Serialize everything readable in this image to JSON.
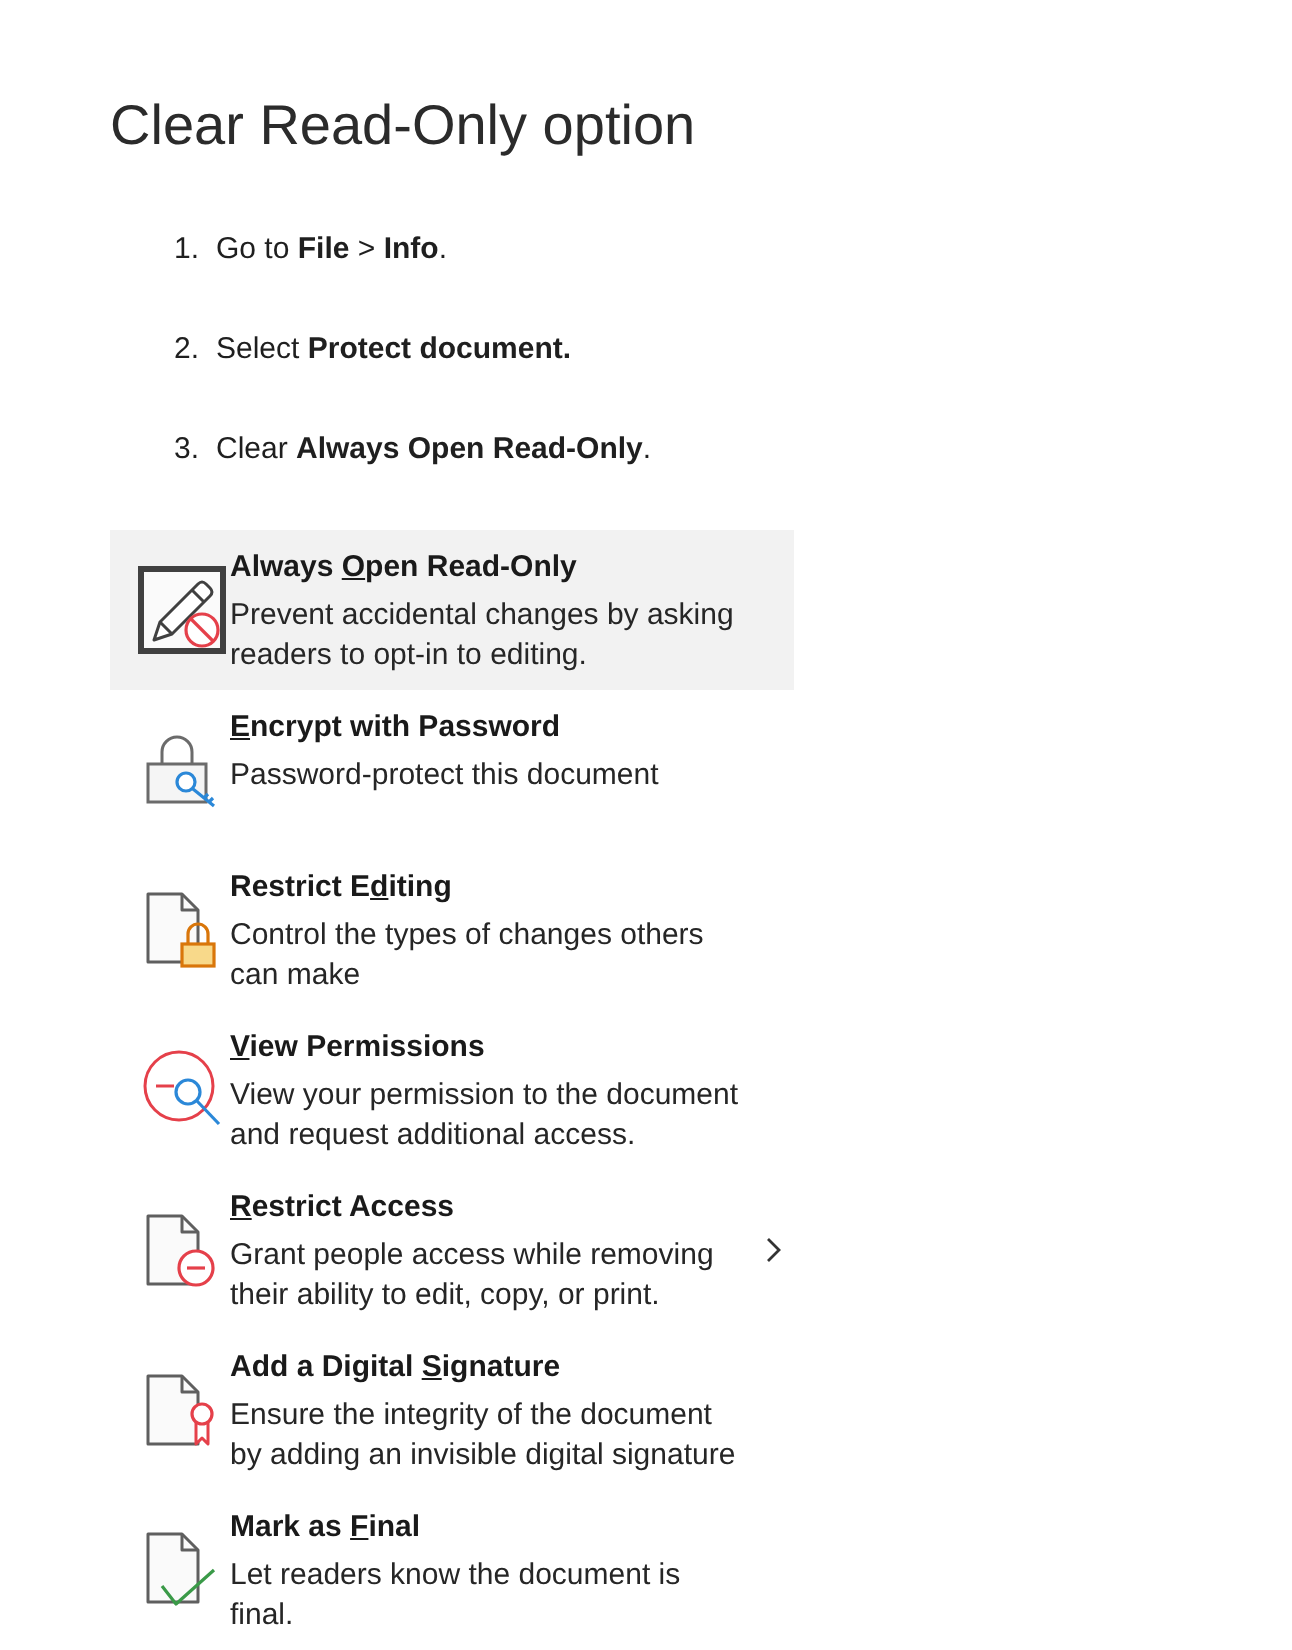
{
  "title": "Clear Read-Only option",
  "steps": [
    {
      "number": "1.",
      "text": "Go to **File** > **Info**."
    },
    {
      "number": "2.",
      "text": "Select **Protect document.**"
    },
    {
      "number": "3.",
      "text": "Clear **Always Open Read-Only**."
    }
  ],
  "menu": {
    "items": [
      {
        "title": [
          {
            "text": "Always ",
            "access_key": false
          },
          {
            "text": "O",
            "access_key": true
          },
          {
            "text": "pen Read-Only",
            "access_key": false
          }
        ],
        "description": "Prevent accidental changes by asking readers to opt-in to editing.",
        "selected": true,
        "submenu": false
      },
      {
        "title": [
          {
            "text": "E",
            "access_key": true
          },
          {
            "text": "ncrypt with Password",
            "access_key": false
          }
        ],
        "description": "Password-protect this document",
        "selected": false,
        "submenu": false
      },
      {
        "title": [
          {
            "text": "Restrict E",
            "access_key": false
          },
          {
            "text": "d",
            "access_key": true
          },
          {
            "text": "iting",
            "access_key": false
          }
        ],
        "description": "Control the types of changes others can make",
        "selected": false,
        "submenu": false
      },
      {
        "title": [
          {
            "text": "V",
            "access_key": true
          },
          {
            "text": "iew Permissions",
            "access_key": false
          }
        ],
        "description": "View your permission to the document and request additional access.",
        "selected": false,
        "submenu": false
      },
      {
        "title": [
          {
            "text": "R",
            "access_key": true
          },
          {
            "text": "estrict Access",
            "access_key": false
          }
        ],
        "description": "Grant people access while removing their ability to edit, copy, or print.",
        "selected": false,
        "submenu": true
      },
      {
        "title": [
          {
            "text": "Add a Digital ",
            "access_key": false
          },
          {
            "text": "S",
            "access_key": true
          },
          {
            "text": "ignature",
            "access_key": false
          }
        ],
        "description": "Ensure the integrity of the document by adding an invisible digital signature",
        "selected": false,
        "submenu": false
      },
      {
        "title": [
          {
            "text": "Mark as ",
            "access_key": false
          },
          {
            "text": "F",
            "access_key": true
          },
          {
            "text": "inal",
            "access_key": false
          }
        ],
        "description": "Let readers know the document is final.",
        "selected": false,
        "submenu": false
      }
    ]
  }
}
